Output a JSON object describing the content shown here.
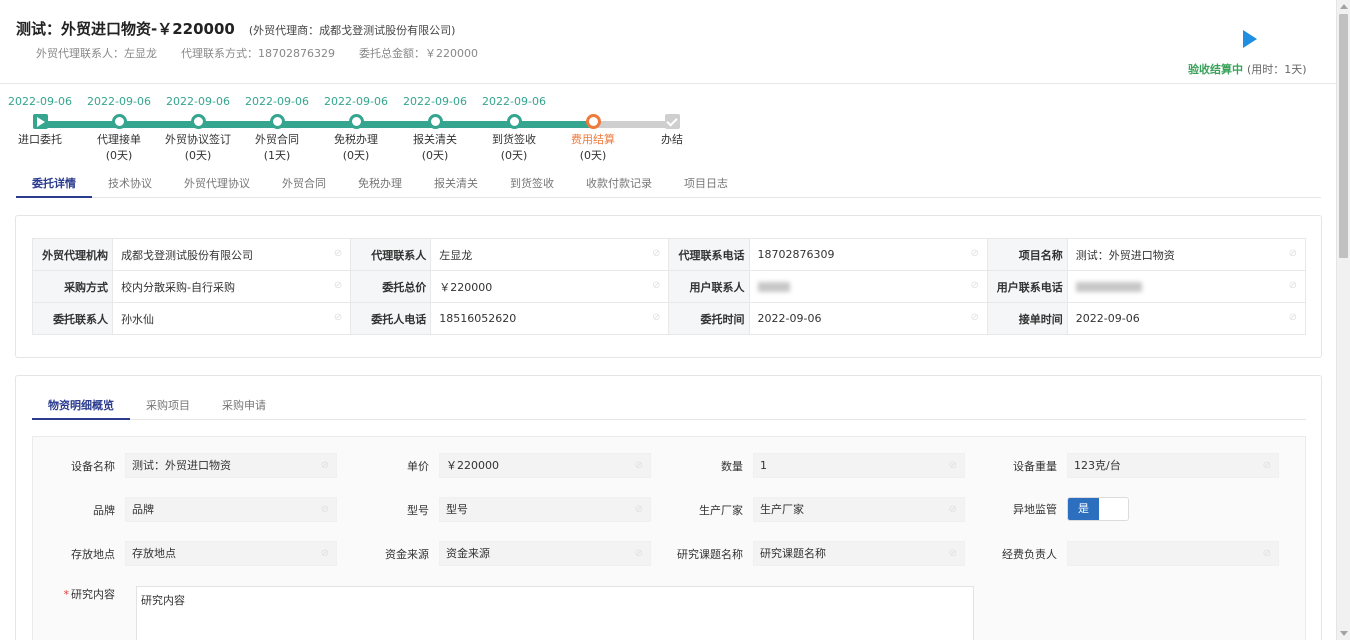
{
  "header": {
    "title": "测试：外贸进口物资-￥220000",
    "agent_note": "(外贸代理商：成都戈登测试股份有限公司)",
    "contact": "外贸代理联系人：左显龙",
    "phone": "代理联系方式：18702876329",
    "total": "委托总金额：￥220000",
    "status": "验收结算中",
    "status_time": "(用时：1天)",
    "play_icon": "play-icon"
  },
  "steps": [
    {
      "date": "2022-09-06",
      "label": "进口委托",
      "days": "",
      "state": "start"
    },
    {
      "date": "2022-09-06",
      "label": "代理接单",
      "days": "(0天)",
      "state": "done"
    },
    {
      "date": "2022-09-06",
      "label": "外贸协议签订",
      "days": "(0天)",
      "state": "done"
    },
    {
      "date": "2022-09-06",
      "label": "外贸合同",
      "days": "(1天)",
      "state": "done"
    },
    {
      "date": "2022-09-06",
      "label": "免税办理",
      "days": "(0天)",
      "state": "done"
    },
    {
      "date": "2022-09-06",
      "label": "报关清关",
      "days": "(0天)",
      "state": "done"
    },
    {
      "date": "2022-09-06",
      "label": "到货签收",
      "days": "(0天)",
      "state": "done"
    },
    {
      "date": "",
      "label": "费用结算",
      "days": "(0天)",
      "state": "current"
    },
    {
      "date": "",
      "label": "办结",
      "days": "",
      "state": "pending"
    }
  ],
  "tabs": [
    "委托详情",
    "技术协议",
    "外贸代理协议",
    "外贸合同",
    "免税办理",
    "报关清关",
    "到货签收",
    "收款付款记录",
    "项目日志"
  ],
  "info": {
    "agency_label": "外贸代理机构",
    "agency": "成都戈登测试股份有限公司",
    "contact_label": "代理联系人",
    "contact": "左显龙",
    "phone_label": "代理联系电话",
    "phone": "18702876309",
    "project_label": "项目名称",
    "project": "测试：外贸进口物资",
    "method_label": "采购方式",
    "method": "校内分散采购-自行采购",
    "price_label": "委托总价",
    "price": "￥220000",
    "user_label": "用户联系人",
    "user_phone_label": "用户联系电话",
    "delegate_label": "委托联系人",
    "delegate": "孙水仙",
    "delegate_phone_label": "委托人电话",
    "delegate_phone": "18516052620",
    "time_label": "委托时间",
    "time": "2022-09-06",
    "accept_label": "接单时间",
    "accept": "2022-09-06"
  },
  "subtabs": [
    "物资明细概览",
    "采购项目",
    "采购申请"
  ],
  "form": {
    "device_label": "设备名称",
    "device": "测试：外贸进口物资",
    "unit_label": "单价",
    "unit": "￥220000",
    "qty_label": "数量",
    "qty": "1",
    "weight_label": "设备重量",
    "weight": "123克/台",
    "brand_label": "品牌",
    "brand": "品牌",
    "model_label": "型号",
    "model": "型号",
    "maker_label": "生产厂家",
    "maker": "生产厂家",
    "remote_label": "异地监管",
    "remote": "是",
    "place_label": "存放地点",
    "place": "存放地点",
    "fund_label": "资金来源",
    "fund": "资金来源",
    "topic_label": "研究课题名称",
    "topic": "研究课题名称",
    "owner_label": "经费负责人",
    "owner": "",
    "content_label": "研究内容",
    "content": "研究内容",
    "required_mark": "*"
  }
}
